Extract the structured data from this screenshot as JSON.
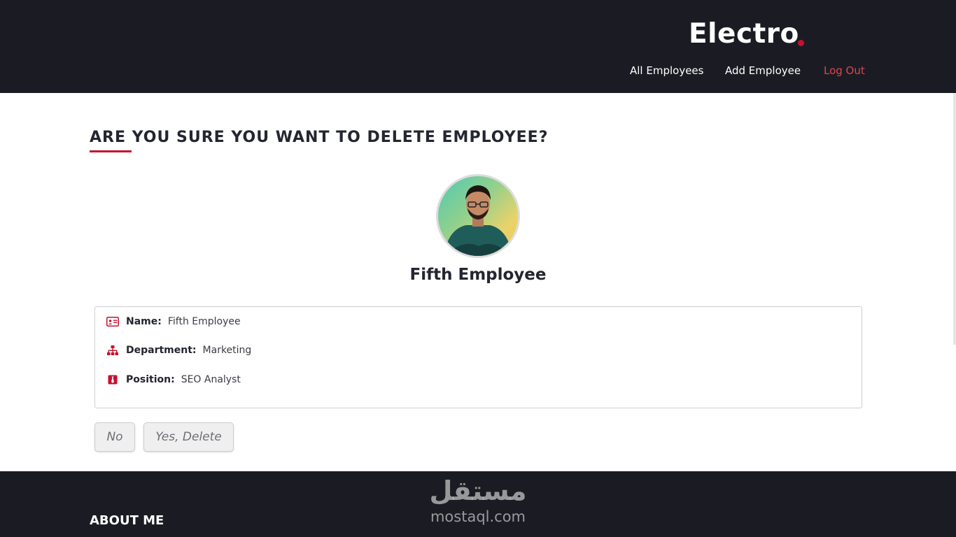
{
  "header": {
    "brand": "Electro",
    "nav": {
      "all_employees": "All Employees",
      "add_employee": "Add Employee",
      "log_out": "Log Out"
    }
  },
  "main": {
    "title": "ARE YOU SURE YOU WANT TO DELETE EMPLOYEE?",
    "employee_name": "Fifth Employee",
    "details": [
      {
        "icon": "id-card-icon",
        "label": "Name:",
        "value": "Fifth Employee"
      },
      {
        "icon": "org-chart-icon",
        "label": "Department:",
        "value": "Marketing"
      },
      {
        "icon": "tie-icon",
        "label": "Position:",
        "value": "SEO Analyst"
      }
    ],
    "buttons": {
      "no": "No",
      "yes_delete": "Yes, Delete"
    }
  },
  "footer": {
    "heading": "ABOUT ME",
    "watermark_arabic": "مستقل",
    "watermark_latin": "mostaql.com"
  },
  "colors": {
    "accent": "#c8102e",
    "header_bg": "#1b1c23",
    "text": "#232530"
  }
}
